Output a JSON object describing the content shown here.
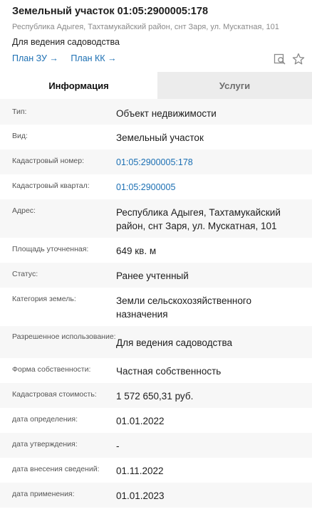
{
  "header": {
    "title": "Земельный участок 01:05:2900005:178",
    "address": "Республика Адыгея, Тахтамукайский район, снт Заря, ул. Мускатная, 101",
    "purpose": "Для ведения садоводства",
    "links": [
      {
        "label": "План ЗУ →"
      },
      {
        "label": "План КК →"
      }
    ],
    "icons": [
      "search-map-icon",
      "star-icon"
    ]
  },
  "tabs": [
    {
      "label": "Информация",
      "active": true
    },
    {
      "label": "Услуги",
      "active": false
    }
  ],
  "colors": {
    "link": "#1b6fb3",
    "tab_inactive_bg": "#ececec",
    "row_alt_bg": "#f7f7f7"
  },
  "rows": [
    {
      "label": "Тип:",
      "value": "Объект недвижимости"
    },
    {
      "label": "Вид:",
      "value": "Земельный участок"
    },
    {
      "label": "Кадастровый номер:",
      "value": "01:05:2900005:178"
    },
    {
      "label": "Кадастровый квартал:",
      "value": "01:05:2900005"
    },
    {
      "label": "Адрес:",
      "value": "Республика Адыгея, Тахтамукайский район, снт Заря, ул. Мускатная, 101"
    },
    {
      "label": "Площадь уточненная:",
      "value": "649 кв. м"
    },
    {
      "label": "Статус:",
      "value": "Ранее учтенный"
    },
    {
      "label": "Категория земель:",
      "value": "Земли сельскохозяйственного назначения"
    },
    {
      "label": "Разрешенное использование:",
      "value": "Для ведения садоводства"
    },
    {
      "label": "Форма собственности:",
      "value": "Частная собственность"
    },
    {
      "label": "Кадастровая стоимость:",
      "value": "1 572 650,31 руб."
    },
    {
      "label": "дата определения:",
      "value": "01.01.2022"
    },
    {
      "label": "дата утверждения:",
      "value": "-"
    },
    {
      "label": "дата внесения сведений:",
      "value": "01.11.2022"
    },
    {
      "label": "дата применения:",
      "value": "01.01.2023"
    }
  ]
}
